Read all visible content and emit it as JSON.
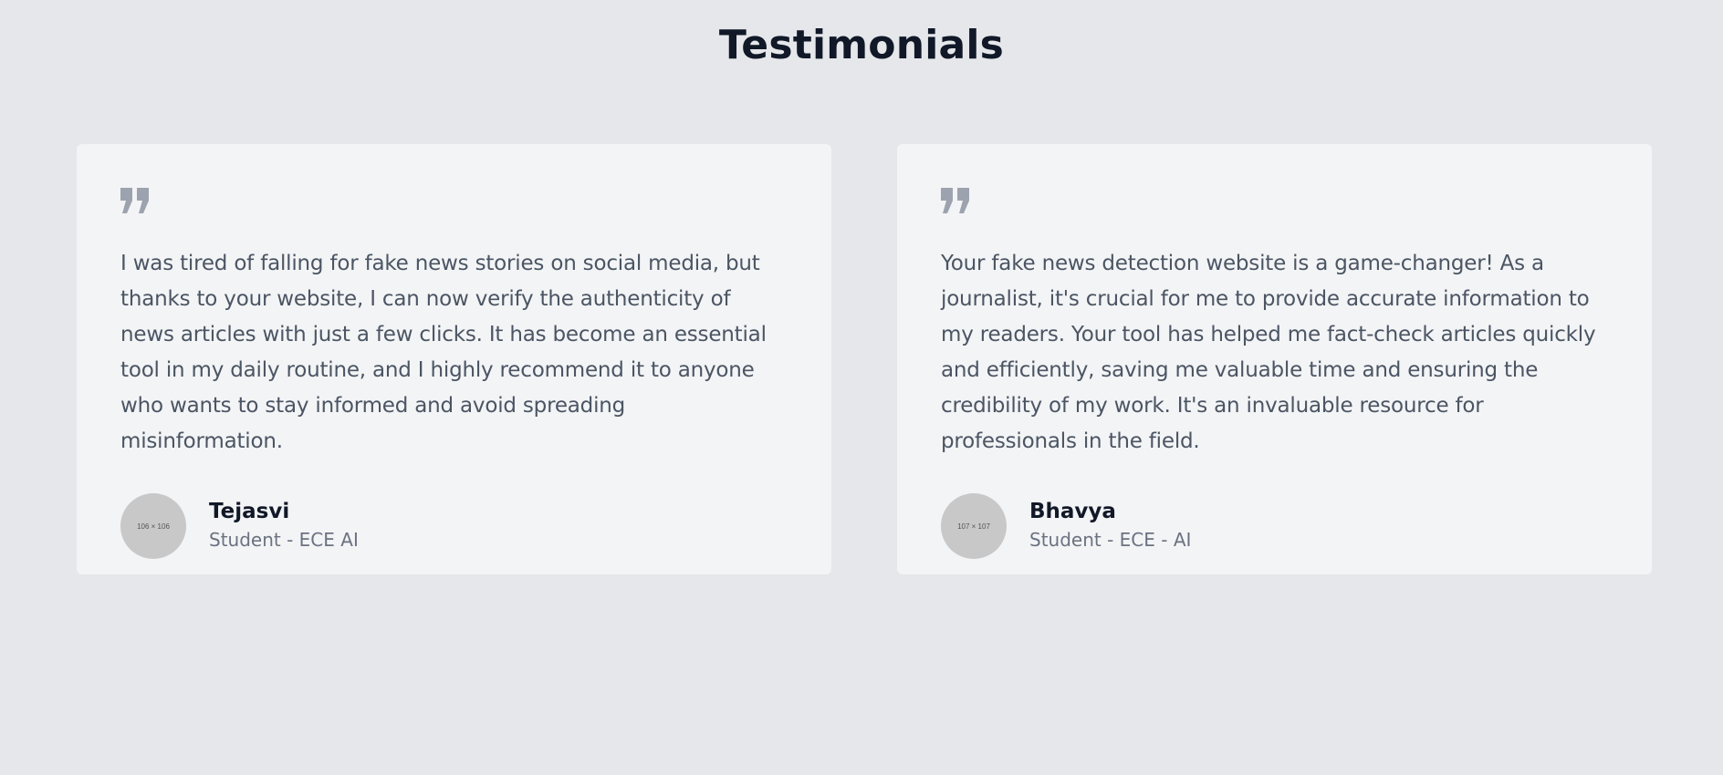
{
  "page": {
    "title": "Testimonials"
  },
  "colors": {
    "background": "#e5e7eb",
    "card": "#f3f4f6",
    "quote_icon": "#9ca3af",
    "text": "#4b5563",
    "heading": "#111827"
  },
  "testimonials": [
    {
      "icon": "quote-icon",
      "text": "I was tired of falling for fake news stories on social media, but thanks to your website, I can now verify the authenticity of news articles with just a few clicks. It has become an essential tool in my daily routine, and I highly recommend it to anyone who wants to stay informed and avoid spreading misinformation.",
      "avatar_label": "106 × 106",
      "name": "Tejasvi",
      "role": "Student - ECE AI"
    },
    {
      "icon": "quote-icon",
      "text": "Your fake news detection website is a game-changer! As a journalist, it's crucial for me to provide accurate information to my readers. Your tool has helped me fact-check articles quickly and efficiently, saving me valuable time and ensuring the credibility of my work. It's an invaluable resource for professionals in the field.",
      "avatar_label": "107 × 107",
      "name": "Bhavya",
      "role": "Student - ECE - AI"
    }
  ]
}
